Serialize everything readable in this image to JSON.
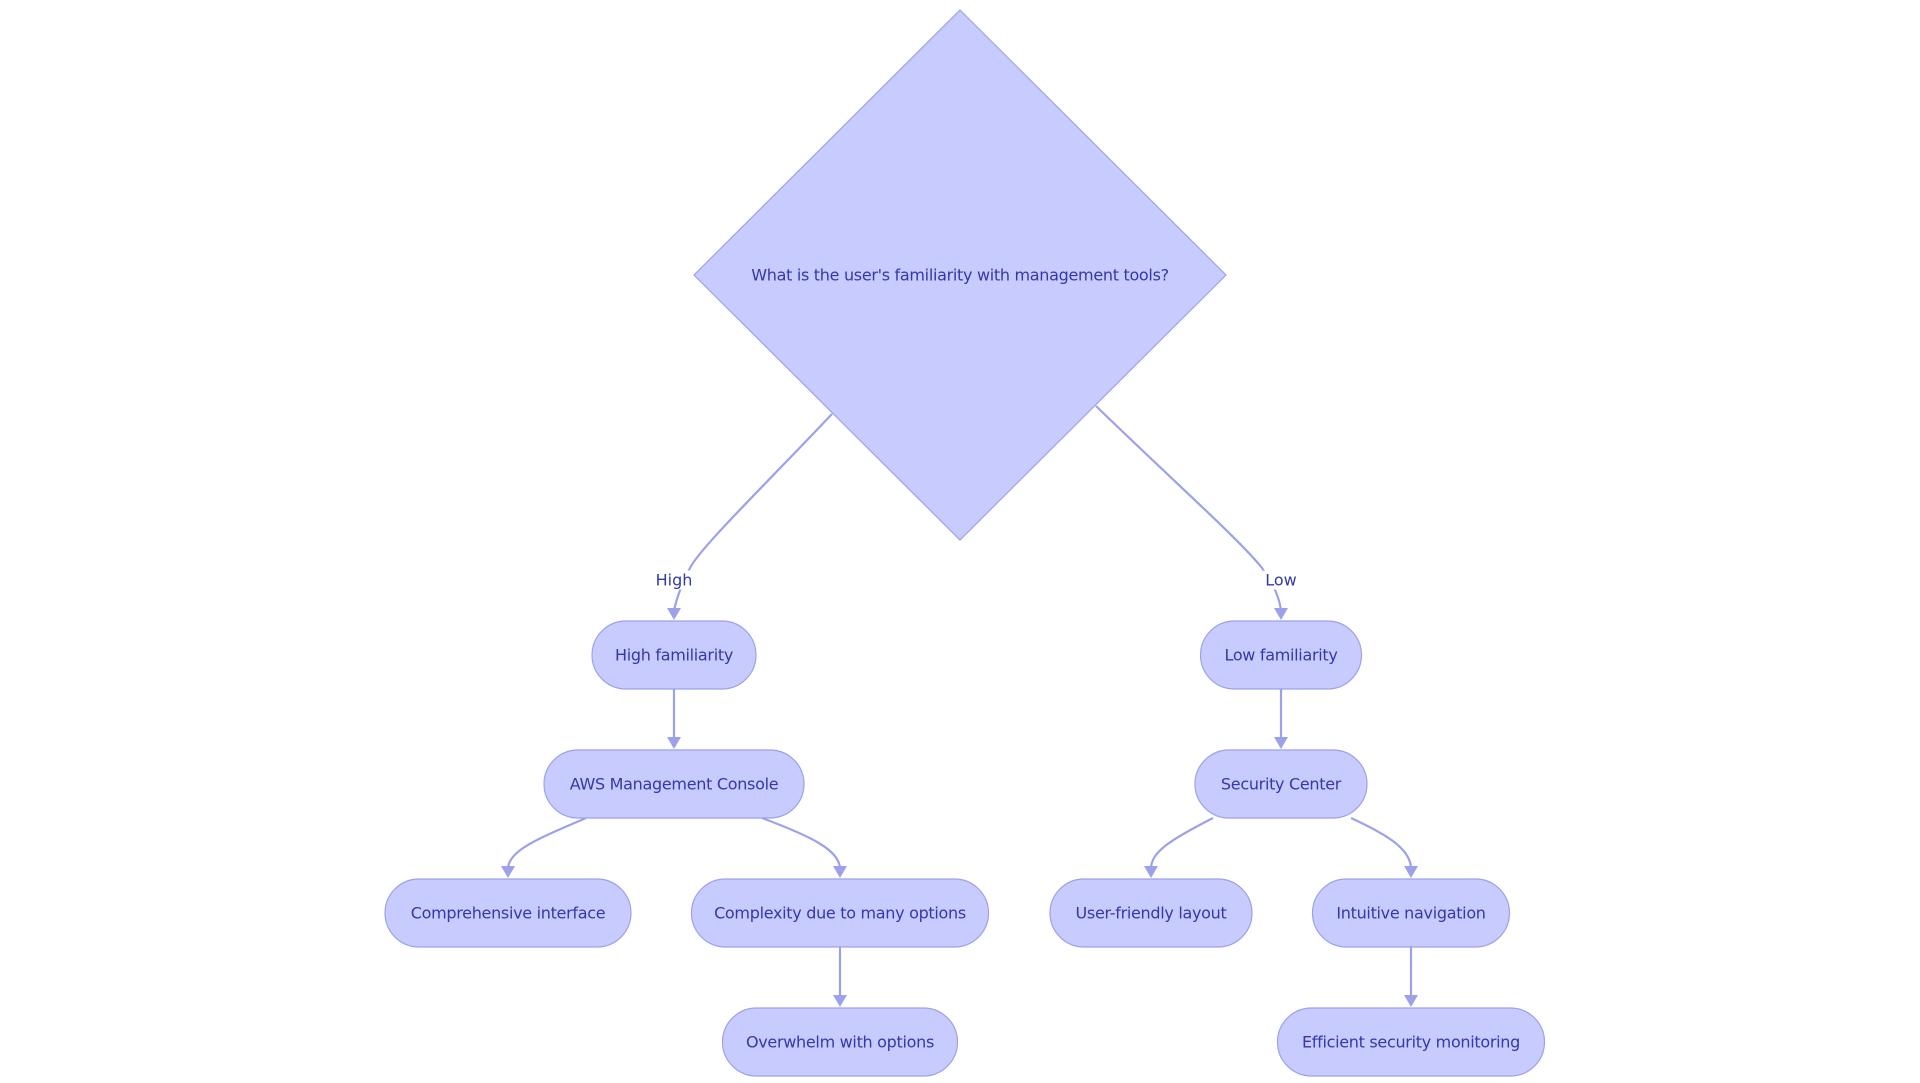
{
  "diagram": {
    "type": "flowchart",
    "colors": {
      "node_fill": "#c7cbfd",
      "node_stroke": "#9da1ea",
      "text": "#3438a9",
      "edge": "#9da1ea",
      "background": "#ffffff"
    },
    "decision": {
      "id": "q",
      "label": "What is the user's familiarity with management tools?"
    },
    "nodes": [
      {
        "id": "high",
        "label": "High familiarity"
      },
      {
        "id": "low",
        "label": "Low familiarity"
      },
      {
        "id": "aws",
        "label": "AWS Management Console"
      },
      {
        "id": "sec",
        "label": "Security Center"
      },
      {
        "id": "comp",
        "label": "Comprehensive interface"
      },
      {
        "id": "cplx",
        "label": "Complexity due to many options"
      },
      {
        "id": "ufl",
        "label": "User-friendly layout"
      },
      {
        "id": "intu",
        "label": "Intuitive navigation"
      },
      {
        "id": "over",
        "label": "Overwhelm with options"
      },
      {
        "id": "eff",
        "label": "Efficient security monitoring"
      }
    ],
    "edges": [
      {
        "from": "q",
        "to": "high",
        "label": "High"
      },
      {
        "from": "q",
        "to": "low",
        "label": "Low"
      },
      {
        "from": "high",
        "to": "aws",
        "label": ""
      },
      {
        "from": "low",
        "to": "sec",
        "label": ""
      },
      {
        "from": "aws",
        "to": "comp",
        "label": ""
      },
      {
        "from": "aws",
        "to": "cplx",
        "label": ""
      },
      {
        "from": "sec",
        "to": "ufl",
        "label": ""
      },
      {
        "from": "sec",
        "to": "intu",
        "label": ""
      },
      {
        "from": "cplx",
        "to": "over",
        "label": ""
      },
      {
        "from": "intu",
        "to": "eff",
        "label": ""
      }
    ]
  }
}
